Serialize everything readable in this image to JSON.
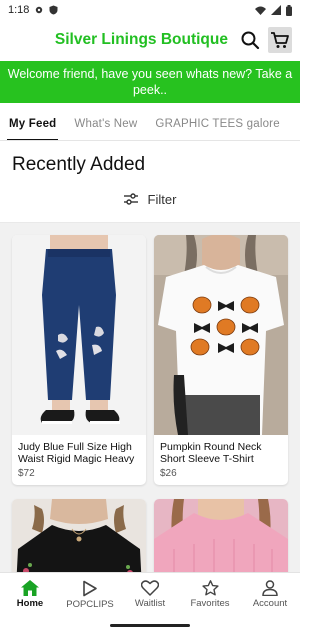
{
  "status_bar": {
    "time": "1:18"
  },
  "header": {
    "brand": "Silver Linings Boutique",
    "icons": [
      "search-icon",
      "cart-icon"
    ]
  },
  "promo": {
    "text": "Welcome friend, have you seen whats new? Take a peek.."
  },
  "tabs": [
    {
      "label": "My Feed",
      "active": true
    },
    {
      "label": "What's New",
      "active": false
    },
    {
      "label": "GRAPHIC TEES galore",
      "active": false
    }
  ],
  "section": {
    "title": "Recently Added",
    "filter_label": "Filter"
  },
  "products": [
    {
      "title": "Judy Blue Full Size High Waist Rigid Magic Heavy",
      "price": "$72"
    },
    {
      "title": "Pumpkin Round Neck Short Sleeve T-Shirt",
      "price": "$26"
    }
  ],
  "bottom_nav": [
    {
      "label": "Home",
      "icon": "home-icon",
      "active": true
    },
    {
      "label": "POPCLIPS",
      "icon": "play-icon",
      "active": false
    },
    {
      "label": "Waitlist",
      "icon": "heart-icon",
      "active": false
    },
    {
      "label": "Favorites",
      "icon": "star-icon",
      "active": false
    },
    {
      "label": "Account",
      "icon": "person-icon",
      "active": false
    }
  ],
  "colors": {
    "brand": "#22bf22",
    "promo_bg": "#27c21f"
  }
}
